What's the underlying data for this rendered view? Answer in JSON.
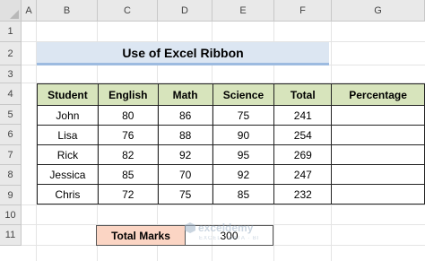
{
  "sheet": {
    "columns": [
      "A",
      "B",
      "C",
      "D",
      "E",
      "F",
      "G"
    ],
    "rows": [
      "1",
      "2",
      "3",
      "4",
      "5",
      "6",
      "7",
      "8",
      "9",
      "10",
      "11"
    ],
    "title": "Use of Excel Ribbon",
    "headers": [
      "Student",
      "English",
      "Math",
      "Science",
      "Total",
      "Percentage"
    ],
    "records": [
      [
        "John",
        "80",
        "86",
        "75",
        "241",
        ""
      ],
      [
        "Lisa",
        "76",
        "88",
        "90",
        "254",
        ""
      ],
      [
        "Rick",
        "82",
        "92",
        "95",
        "269",
        ""
      ],
      [
        "Jessica",
        "85",
        "70",
        "92",
        "247",
        ""
      ],
      [
        "Chris",
        "72",
        "75",
        "85",
        "232",
        ""
      ]
    ],
    "total_marks_label": "Total Marks",
    "total_marks_value": "300"
  },
  "watermark": {
    "text": "exceldemy",
    "sub": "EXCEL · DATA · BI"
  },
  "colors": {
    "title_fill": "#dce6f2",
    "header_fill": "#d7e4bc",
    "total_marks_fill": "#fbd5c4"
  }
}
